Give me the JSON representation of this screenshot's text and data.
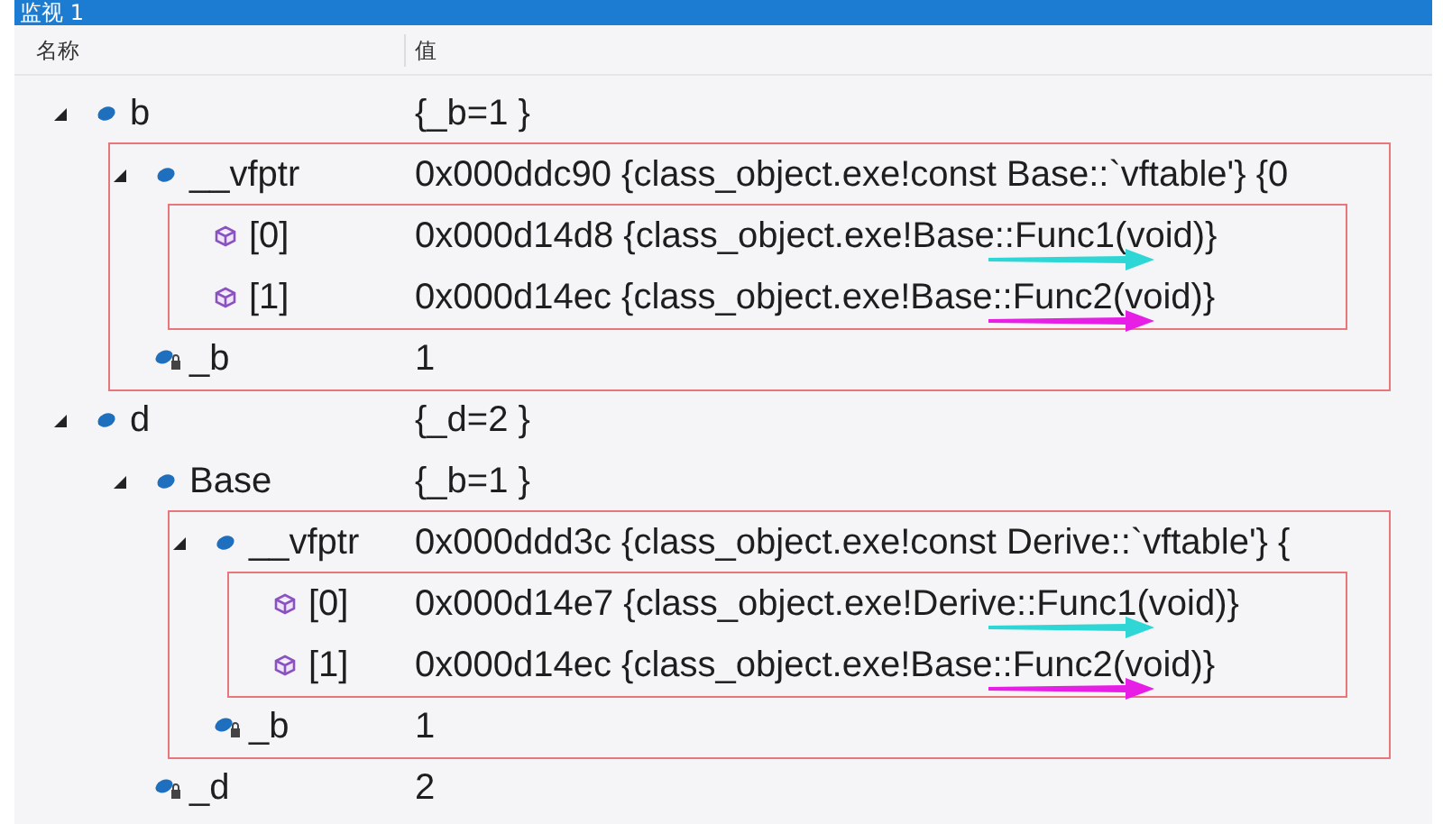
{
  "window": {
    "title": "监视 1"
  },
  "columns": [
    "名称",
    "值"
  ],
  "tree": [
    {
      "name": "b",
      "kind": "object",
      "value": "{_b=1 }",
      "expanded": true,
      "children_framed": true,
      "children": [
        {
          "name": "__vfptr",
          "kind": "object",
          "value": "0x000ddc90 {class_object.exe!const Base::`vftable'} {0",
          "expanded": true,
          "children_framed": true,
          "children": [
            {
              "name": "[0]",
              "kind": "method",
              "value": "0x000d14d8 {class_object.exe!Base::Func1(void)}",
              "arrow": {
                "color": "#2fd6d6"
              }
            },
            {
              "name": "[1]",
              "kind": "method",
              "value": "0x000d14ec {class_object.exe!Base::Func2(void)}",
              "arrow": {
                "color": "#e61ee6"
              }
            }
          ]
        },
        {
          "name": "_b",
          "kind": "private",
          "value": "1"
        }
      ]
    },
    {
      "name": "d",
      "kind": "object",
      "value": "{_d=2 }",
      "expanded": true,
      "children": [
        {
          "name": "Base",
          "kind": "object",
          "value": "{_b=1 }",
          "expanded": true,
          "children_framed": true,
          "children": [
            {
              "name": "__vfptr",
              "kind": "object",
              "value": "0x000ddd3c {class_object.exe!const Derive::`vftable'} {",
              "expanded": true,
              "children_framed": true,
              "children": [
                {
                  "name": "[0]",
                  "kind": "method",
                  "value": "0x000d14e7 {class_object.exe!Derive::Func1(void)}",
                  "arrow": {
                    "color": "#2fd6d6"
                  }
                },
                {
                  "name": "[1]",
                  "kind": "method",
                  "value": "0x000d14ec {class_object.exe!Base::Func2(void)}",
                  "arrow": {
                    "color": "#e61ee6"
                  }
                }
              ]
            },
            {
              "name": "_b",
              "kind": "private",
              "value": "1"
            }
          ]
        },
        {
          "name": "_d",
          "kind": "private",
          "value": "2"
        }
      ]
    }
  ]
}
